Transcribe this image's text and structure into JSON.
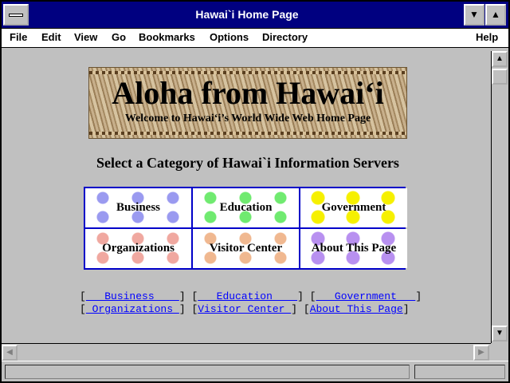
{
  "window": {
    "title": "Hawai`i Home Page"
  },
  "menu": {
    "file": "File",
    "edit": "Edit",
    "view": "View",
    "go": "Go",
    "bookmarks": "Bookmarks",
    "options": "Options",
    "directory": "Directory",
    "help": "Help"
  },
  "banner": {
    "title": "Aloha from Hawai‘i",
    "subtitle": "Welcome to Hawai‘i’s World Wide Web Home Page"
  },
  "heading": "Select a Category of Hawai`i Information Servers",
  "categories": [
    {
      "label": "Business",
      "color": "#9a9af0"
    },
    {
      "label": "Education",
      "color": "#70ea70"
    },
    {
      "label": "Government",
      "color": "#f6f000"
    },
    {
      "label": "Organizations",
      "color": "#f0a8a0"
    },
    {
      "label": "Visitor Center",
      "color": "#f0b890"
    },
    {
      "label": "About This Page",
      "color": "#b890f0"
    }
  ],
  "text_links": [
    "   Business    ",
    "   Education    ",
    "   Government   ",
    " Organizations ",
    "Visitor Center ",
    "About This Page"
  ],
  "colors": {
    "titlebar": "#000080",
    "link": "#0000ff",
    "grid_border": "#0000c8"
  }
}
